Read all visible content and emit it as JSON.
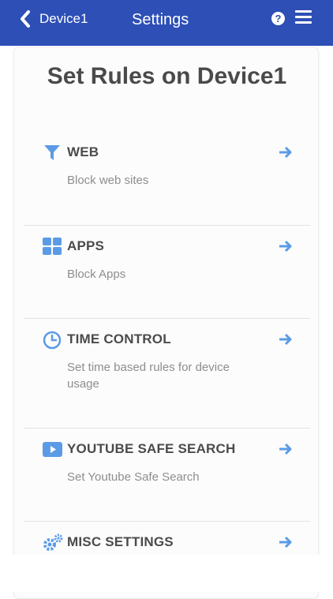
{
  "header": {
    "back_label": "Device1",
    "title": "Settings",
    "help_label": "?"
  },
  "page": {
    "title": "Set Rules on Device1"
  },
  "rules": [
    {
      "icon": "filter-icon",
      "title": "WEB",
      "desc": "Block web sites"
    },
    {
      "icon": "apps-grid-icon",
      "title": "APPS",
      "desc": "Block Apps"
    },
    {
      "icon": "clock-icon",
      "title": "TIME CONTROL",
      "desc": "Set time based rules for device usage"
    },
    {
      "icon": "youtube-play-icon",
      "title": "YOUTUBE SAFE SEARCH",
      "desc": "Set Youtube Safe Search"
    },
    {
      "icon": "gears-icon",
      "title": "MISC SETTINGS",
      "desc": ""
    }
  ],
  "colors": {
    "header_bg": "#2d4fb6",
    "accent": "#5b9be6",
    "title_text": "#4a4a4a",
    "desc_text": "#8e8e8e"
  }
}
